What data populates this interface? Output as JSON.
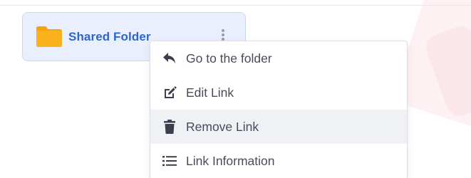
{
  "folder": {
    "name": "Shared Folder",
    "icon": "folder-icon",
    "more_icon": "more-vertical-icon"
  },
  "context_menu": {
    "items": [
      {
        "label": "Go to the folder",
        "icon": "reply-arrow-icon"
      },
      {
        "label": "Edit Link",
        "icon": "edit-icon"
      },
      {
        "label": "Remove Link",
        "icon": "trash-icon",
        "highlighted": true
      },
      {
        "label": "Link Information",
        "icon": "list-icon"
      }
    ]
  },
  "colors": {
    "accent": "#2f65c8",
    "folder_yellow": "#fbb31d",
    "card_bg": "#e9effd",
    "menu_text": "#4a4a5c",
    "hover_bg": "#f0f1f5"
  }
}
